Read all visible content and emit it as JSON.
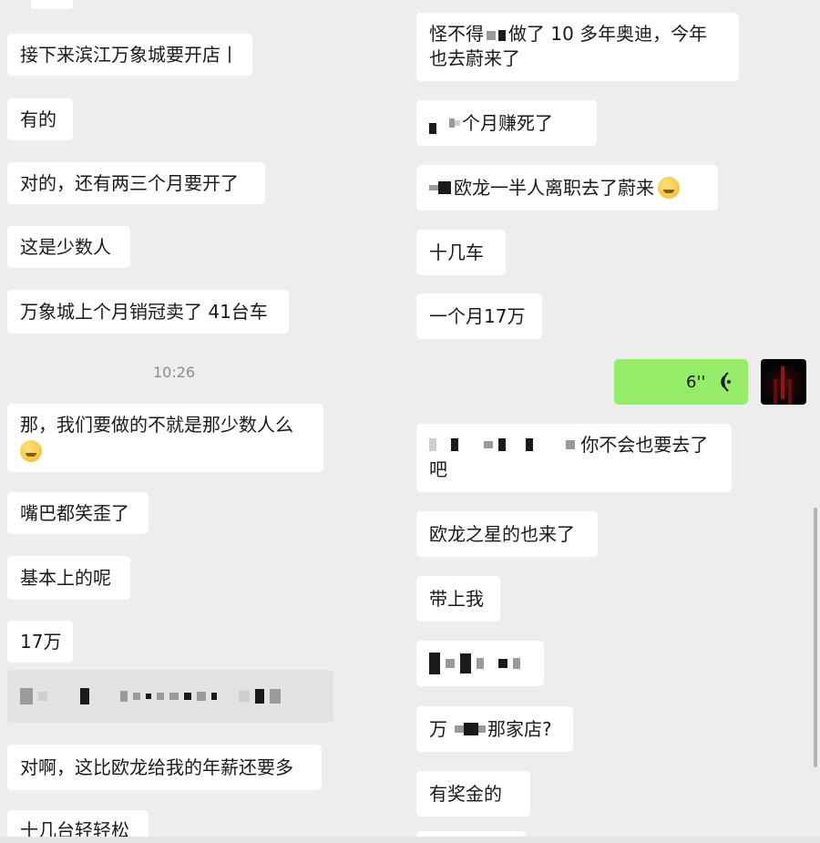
{
  "left": {
    "messages": [
      {
        "text": "接下来滨江万象城要开店丨"
      },
      {
        "text": "有的"
      },
      {
        "text": "对的，还有两三个月要开了"
      },
      {
        "text": "这是少数人"
      },
      {
        "text": "万象城上个月销冠卖了 41台车"
      },
      {
        "text": "那，我们要做的不就是那少数人么"
      },
      {
        "text": "嘴巴都笑歪了"
      },
      {
        "text": "基本上的呢"
      },
      {
        "text": "17万"
      },
      {
        "text": "对啊，这比欧龙给我的年薪还要多"
      },
      {
        "text": "十几台轻轻松"
      }
    ],
    "timestamp": "10:26"
  },
  "right": {
    "messages": [
      {
        "text_a": "怪不得",
        "text_b": "做了 10 多年奥迪，今年",
        "text_c": "也去蔚来了"
      },
      {
        "text": "个月赚死了"
      },
      {
        "text": "欧龙一半人离职去了蔚来"
      },
      {
        "text": "十几车"
      },
      {
        "text": "一个月17万"
      },
      {
        "voice_duration": "6''",
        "voice_icon": "voice-wave-icon"
      },
      {
        "text_a": "你不会也要去了",
        "text_b": "吧"
      },
      {
        "text": "欧龙之星的也来了"
      },
      {
        "text": "带上我"
      },
      {
        "text": ""
      },
      {
        "text_a": "万",
        "text_b": "那家店?"
      },
      {
        "text": "有奖金的"
      }
    ]
  },
  "colors": {
    "background": "#ededed",
    "bubble_received": "#ffffff",
    "bubble_sent": "#95ec69",
    "timestamp": "#8c8c8c"
  }
}
